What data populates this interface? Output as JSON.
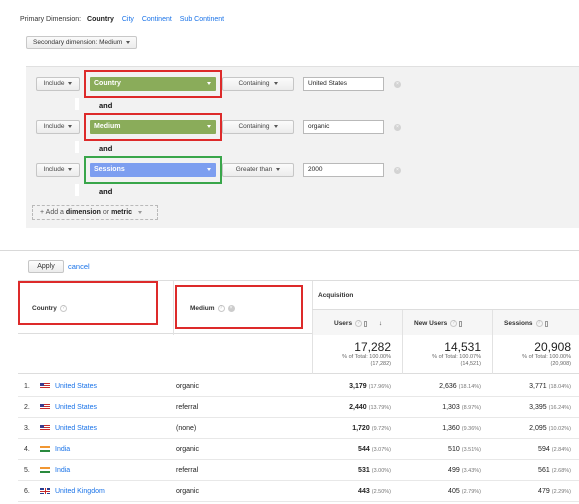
{
  "primary_dimension": {
    "label": "Primary Dimension:",
    "options": [
      "Country",
      "City",
      "Continent",
      "Sub Continent"
    ]
  },
  "secondary_dimension": {
    "label": "Secondary dimension: Medium"
  },
  "filters": [
    {
      "include": "Include",
      "field": "Country",
      "field_color": "#8aac5a",
      "operator": "Containing",
      "value": "United States"
    },
    {
      "include": "Include",
      "field": "Medium",
      "field_color": "#8aac5a",
      "operator": "Containing",
      "value": "organic"
    },
    {
      "include": "Include",
      "field": "Sessions",
      "field_color": "#7d9ef0",
      "operator": "Greater than",
      "value": "2000"
    }
  ],
  "and_label": "and",
  "add_filter": {
    "prefix": "+ Add a",
    "dimension": "dimension",
    "or": "or",
    "metric": "metric"
  },
  "apply_label": "Apply",
  "cancel_label": "cancel",
  "table": {
    "columns": {
      "country": "Country",
      "medium": "Medium",
      "group": "Acquisition",
      "users": "Users",
      "new_users": "New Users",
      "sessions": "Sessions"
    },
    "totals": {
      "users": {
        "value": "17,282",
        "line1": "% of Total: 100.00%",
        "line2": "(17,282)"
      },
      "new_users": {
        "value": "14,531",
        "line1": "% of Total: 100.07%",
        "line2": "(14,521)"
      },
      "sessions": {
        "value": "20,908",
        "line1": "% of Total: 100.00%",
        "line2": "(20,908)"
      }
    },
    "rows": [
      {
        "n": "1.",
        "flag": "us",
        "country": "United States",
        "medium": "organic",
        "users": "3,179",
        "users_pct": "(17.96%)",
        "new_users": "2,636",
        "new_users_pct": "(18.14%)",
        "sessions": "3,771",
        "sessions_pct": "(18.04%)"
      },
      {
        "n": "2.",
        "flag": "us",
        "country": "United States",
        "medium": "referral",
        "users": "2,440",
        "users_pct": "(13.79%)",
        "new_users": "1,303",
        "new_users_pct": "(8.97%)",
        "sessions": "3,395",
        "sessions_pct": "(16.24%)"
      },
      {
        "n": "3.",
        "flag": "us",
        "country": "United States",
        "medium": "(none)",
        "users": "1,720",
        "users_pct": "(9.72%)",
        "new_users": "1,360",
        "new_users_pct": "(9.36%)",
        "sessions": "2,095",
        "sessions_pct": "(10.02%)"
      },
      {
        "n": "4.",
        "flag": "in",
        "country": "India",
        "medium": "organic",
        "users": "544",
        "users_pct": "(3.07%)",
        "new_users": "510",
        "new_users_pct": "(3.51%)",
        "sessions": "594",
        "sessions_pct": "(2.84%)"
      },
      {
        "n": "5.",
        "flag": "in",
        "country": "India",
        "medium": "referral",
        "users": "531",
        "users_pct": "(3.00%)",
        "new_users": "499",
        "new_users_pct": "(3.43%)",
        "sessions": "561",
        "sessions_pct": "(2.68%)"
      },
      {
        "n": "6.",
        "flag": "gb",
        "country": "United Kingdom",
        "medium": "organic",
        "users": "443",
        "users_pct": "(2.50%)",
        "new_users": "405",
        "new_users_pct": "(2.79%)",
        "sessions": "479",
        "sessions_pct": "(2.29%)"
      }
    ]
  }
}
